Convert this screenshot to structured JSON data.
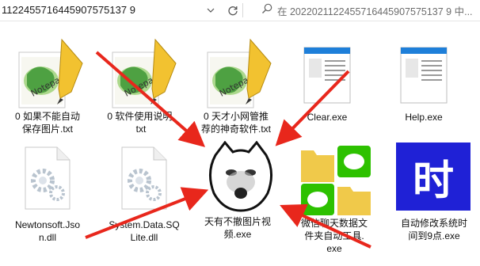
{
  "address": {
    "text": "1122455716445907575137 9"
  },
  "toolbar": {
    "dropdown_icon": "chevron-down-icon",
    "refresh_icon": "refresh-icon"
  },
  "search": {
    "placeholder": "在 2022021122455716445907575137 9 中..."
  },
  "files": [
    {
      "label": "0 如果不能自动\n保存图片.txt",
      "icon": "notepad-icon"
    },
    {
      "label": "0 软件使用说明.\ntxt",
      "icon": "notepad-icon"
    },
    {
      "label": "0 天才小网管推\n荐的神奇软件.txt",
      "icon": "notepad-icon"
    },
    {
      "label": "Clear.exe",
      "icon": "window-exe-icon"
    },
    {
      "label": "Help.exe",
      "icon": "window-exe-icon"
    },
    {
      "label": "Newtonsoft.Jso\nn.dll",
      "icon": "dll-gear-icon"
    },
    {
      "label": "System.Data.SQ\nLite.dll",
      "icon": "dll-gear-icon"
    },
    {
      "label": "天有不撤图片视\n频.exe",
      "icon": "meme-face-icon"
    },
    {
      "label": "微信聊天数据文\n件夹自动工具.\nexe",
      "icon": "wechat-folders-icon"
    },
    {
      "label": "自动修改系统时\n间到9点.exe",
      "icon": "time-char-icon"
    }
  ],
  "time_char": "时",
  "colors": {
    "arrow": "#e8271c",
    "time_bg": "#1f21d6",
    "wechat_green": "#2dc100",
    "folder_yellow": "#f0c94a"
  }
}
